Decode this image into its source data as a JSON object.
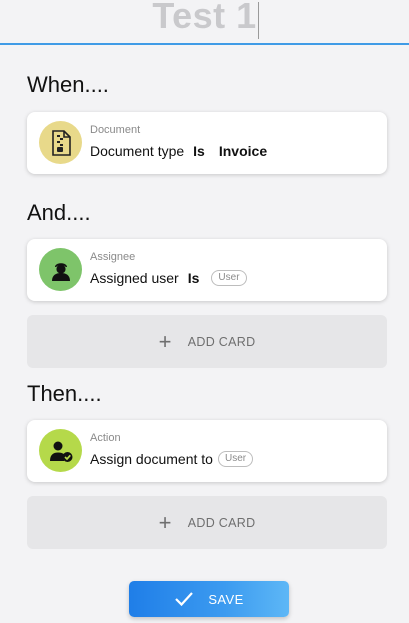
{
  "title": "Test 1",
  "sections": {
    "when": {
      "heading": "When...."
    },
    "and": {
      "heading": "And...."
    },
    "then": {
      "heading": "Then...."
    }
  },
  "cards": {
    "document": {
      "icon": "document-icon",
      "icon_color": "#e8d98a",
      "caption": "Document",
      "field": "Document type",
      "operator": "Is",
      "value": "Invoice"
    },
    "assignee": {
      "icon": "user-icon",
      "icon_color": "#7ec46a",
      "caption": "Assignee",
      "field": "Assigned user",
      "operator": "Is",
      "value_pill": "User"
    },
    "action": {
      "icon": "user-check-icon",
      "icon_color": "#b5d94a",
      "caption": "Action",
      "field": "Assign document to",
      "value_pill": "User"
    }
  },
  "add_card": {
    "label": "ADD CARD"
  },
  "save": {
    "label": "SAVE"
  },
  "colors": {
    "accent": "#3f9be6",
    "save_gradient_start": "#1f7ee8",
    "save_gradient_end": "#5db7f6"
  }
}
